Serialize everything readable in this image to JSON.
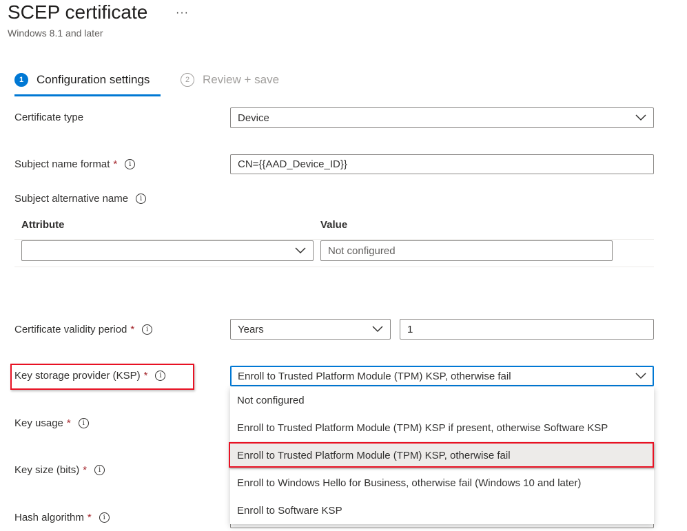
{
  "header": {
    "title": "SCEP certificate",
    "more_label": "···",
    "subtitle": "Windows 8.1 and later"
  },
  "steps": [
    {
      "number": "1",
      "label": "Configuration settings",
      "active": true
    },
    {
      "number": "2",
      "label": "Review + save",
      "active": false
    }
  ],
  "form": {
    "certificate_type": {
      "label": "Certificate type",
      "value": "Device"
    },
    "subject_name_format": {
      "label": "Subject name format",
      "value": "CN={{AAD_Device_ID}}",
      "required": "*",
      "info": "i"
    },
    "subject_alternative_name": {
      "label": "Subject alternative name",
      "info": "i",
      "columns": {
        "attribute": "Attribute",
        "value": "Value"
      },
      "attribute_value": "",
      "value_placeholder": "Not configured"
    },
    "certificate_validity_period": {
      "label": "Certificate validity period",
      "required": "*",
      "info": "i",
      "unit": "Years",
      "amount": "1"
    },
    "key_storage_provider": {
      "label": "Key storage provider (KSP)",
      "required": "*",
      "info": "i",
      "value": "Enroll to Trusted Platform Module (TPM) KSP, otherwise fail",
      "options": [
        "Not configured",
        "Enroll to Trusted Platform Module (TPM) KSP if present, otherwise Software KSP",
        "Enroll to Trusted Platform Module (TPM) KSP, otherwise fail",
        "Enroll to Windows Hello for Business, otherwise fail (Windows 10 and later)",
        "Enroll to Software KSP"
      ],
      "selected_option": "Enroll to Trusted Platform Module (TPM) KSP, otherwise fail"
    },
    "key_usage": {
      "label": "Key usage",
      "required": "*",
      "info": "i"
    },
    "key_size": {
      "label": "Key size (bits)",
      "required": "*",
      "info": "i"
    },
    "hash_algorithm": {
      "label": "Hash algorithm",
      "required": "*",
      "info": "i"
    }
  },
  "colors": {
    "accent": "#0078d4",
    "required": "#a4262c",
    "highlight_border": "#e81123",
    "selected_option_bg": "#edebe9"
  },
  "icons": {
    "chevron": "chevron-down-icon",
    "info": "info-icon",
    "more": "more-icon"
  }
}
